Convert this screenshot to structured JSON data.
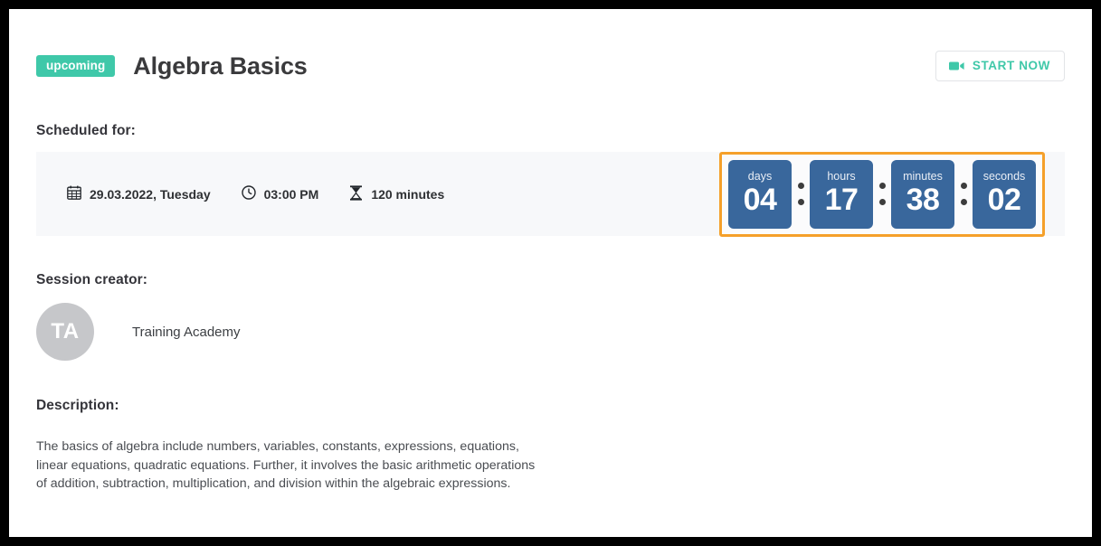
{
  "header": {
    "badge": "upcoming",
    "title": "Algebra Basics",
    "start_button": "START NOW",
    "start_icon": "video-camera-icon",
    "accent_color": "#3fc8a9"
  },
  "scheduled": {
    "label": "Scheduled for:",
    "date": "29.03.2022, Tuesday",
    "date_icon": "calendar-icon",
    "time": "03:00 PM",
    "time_icon": "clock-icon",
    "duration": "120 minutes",
    "duration_icon": "hourglass-icon",
    "panel_color": "#f7f8fa"
  },
  "countdown": {
    "highlight_color": "#f5a02a",
    "tile_color": "#39679c",
    "separator": ":",
    "units": [
      {
        "label": "days",
        "value": "04"
      },
      {
        "label": "hours",
        "value": "17"
      },
      {
        "label": "minutes",
        "value": "38"
      },
      {
        "label": "seconds",
        "value": "02"
      }
    ]
  },
  "creator": {
    "label": "Session creator:",
    "initials": "TA",
    "name": "Training Academy"
  },
  "description": {
    "label": "Description:",
    "text": "The basics of algebra include numbers, variables, constants, expressions, equations,\nlinear equations, quadratic equations. Further, it involves the basic arithmetic operations\nof addition, subtraction, multiplication, and division within the algebraic expressions."
  }
}
